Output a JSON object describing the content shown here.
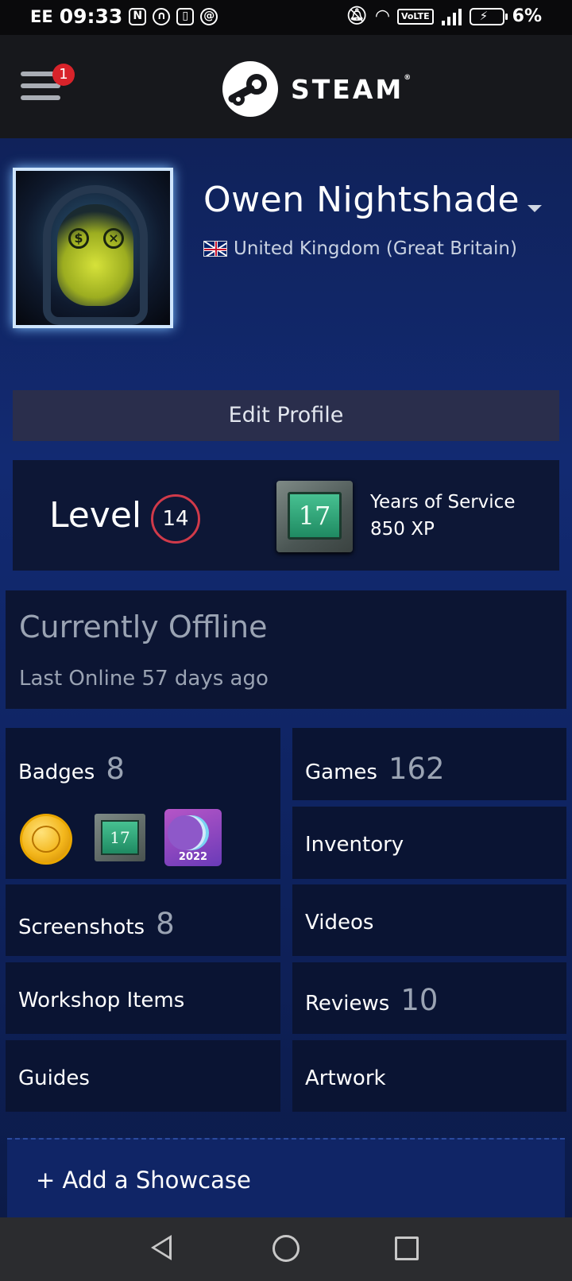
{
  "status_bar": {
    "carrier": "EE",
    "time": "09:33",
    "icons_left": [
      "nfc-icon",
      "headphones-icon",
      "battery-saver-icon",
      "at-icon"
    ],
    "icons_right": [
      "mute-icon",
      "wifi-icon",
      "volte-icon",
      "signal-icon",
      "battery-icon"
    ],
    "volte_label": "VoLTE",
    "battery_percent": "6%"
  },
  "header": {
    "notification_count": "1",
    "logo_text": "STEAM",
    "logo_mark": "®"
  },
  "profile": {
    "username": "Owen Nightshade",
    "country": "United Kingdom (Great Britain)",
    "edit_label": "Edit Profile"
  },
  "level": {
    "label": "Level",
    "value": "14",
    "badge_number": "17",
    "badge_title": "Years of Service",
    "badge_xp": "850 XP"
  },
  "status": {
    "title": "Currently Offline",
    "last_online": "Last Online 57 days ago"
  },
  "stats": {
    "badges": {
      "label": "Badges",
      "count": "8"
    },
    "games": {
      "label": "Games",
      "count": "162"
    },
    "inventory": {
      "label": "Inventory"
    },
    "screenshots": {
      "label": "Screenshots",
      "count": "8"
    },
    "videos": {
      "label": "Videos"
    },
    "workshop": {
      "label": "Workshop Items"
    },
    "reviews": {
      "label": "Reviews",
      "count": "10"
    },
    "guides": {
      "label": "Guides"
    },
    "artwork": {
      "label": "Artwork"
    }
  },
  "badge_icons": {
    "yos_number": "17",
    "year_badge": "2022"
  },
  "showcase": {
    "label": "+ Add a Showcase"
  },
  "colors": {
    "accent_red": "#d8232a",
    "level_ring": "#d03a4a",
    "background": "#122a72"
  }
}
